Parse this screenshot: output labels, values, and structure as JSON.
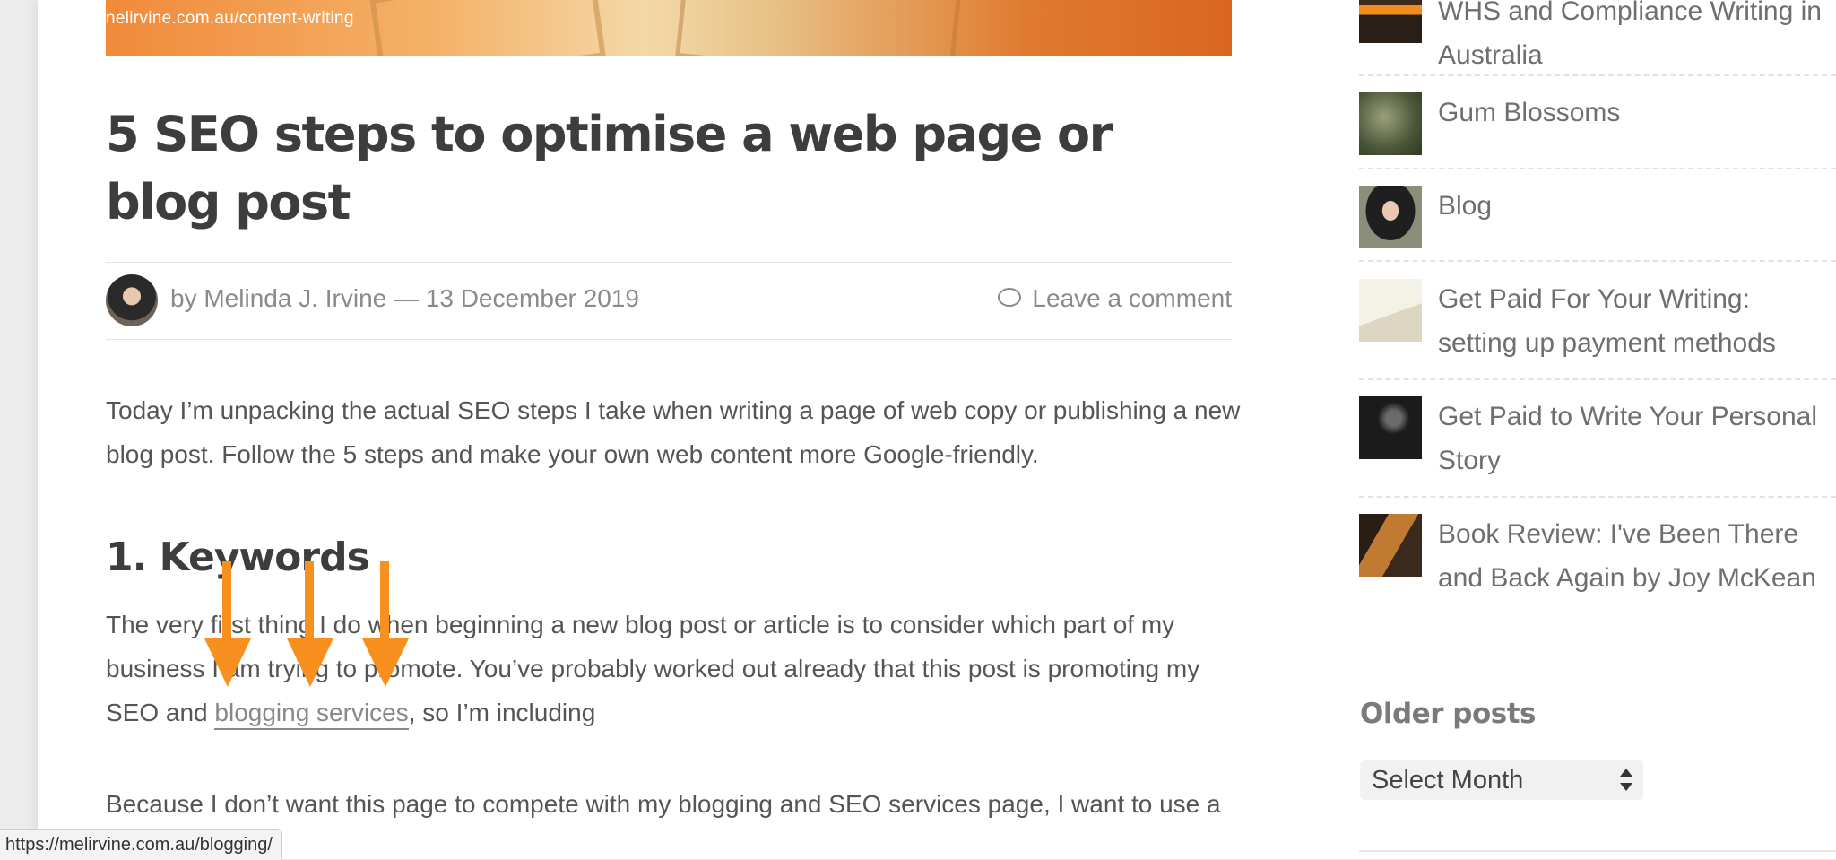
{
  "hero": {
    "url_text": "nelirvine.com.au/content-writing"
  },
  "post": {
    "title": "5 SEO steps to optimise a web page or blog post",
    "byline": "by Melinda J. Irvine  —  13 December 2019",
    "comment_link": "Leave a comment",
    "intro": "Today I’m unpacking the actual SEO steps I take when writing a page of web copy or publishing a new blog post. Follow the 5 steps and make your own web content more Google-friendly.",
    "heading_keywords": "1. Keywords",
    "para2_before": "The very first thing I do when beginning a new blog post or article is to consider which part of my business I am trying to promote. You’ve probably worked out already that this post is promoting my SEO and ",
    "para2_link": "blogging services",
    "para2_after": ", so I’m including",
    "para3": "Because I don’t want this page to compete with my blogging and SEO services page, I want to use a"
  },
  "sidebar": {
    "posts": [
      {
        "label": "WHS and Compliance Writing in Australia",
        "thumb": "whs-compliance-book"
      },
      {
        "label": "Gum Blossoms",
        "thumb": "gum-blossoms-photo"
      },
      {
        "label": "Blog",
        "thumb": "author-portrait"
      },
      {
        "label": "Get Paid For Your Writing: setting up payment methods",
        "thumb": "notebook-planning"
      },
      {
        "label": "Get Paid to Write Your Personal Story",
        "thumb": "personal-story-dark"
      },
      {
        "label": "Book Review: I've Been There and Back Again by Joy McKean",
        "thumb": "book-cover"
      }
    ],
    "older_heading": "Older posts",
    "select_value": "Select Month"
  },
  "status_bar": {
    "url": "https://melirvine.com.au/blogging/"
  },
  "colors": {
    "accent_arrow": "#f7901e",
    "title": "#3d3d3d",
    "hero": "#e07a2e"
  }
}
